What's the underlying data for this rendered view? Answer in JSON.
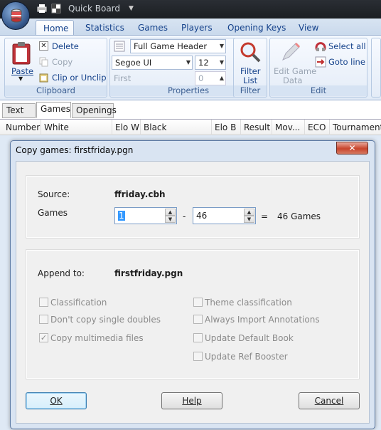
{
  "window": {
    "title": "Quick Board"
  },
  "ribbon": {
    "tabs": [
      "Home",
      "Statistics",
      "Games",
      "Players",
      "Opening Keys",
      "View"
    ],
    "clipboard": {
      "paste": "Paste",
      "delete": "Delete",
      "copy": "Copy",
      "clip": "Clip or Unclip",
      "group": "Clipboard"
    },
    "properties": {
      "header_select": "Full Game Header",
      "font_select": "Segoe UI",
      "size_select": "12",
      "first_label": "First",
      "first_value": "0",
      "group": "Properties"
    },
    "filter": {
      "label1": "Filter",
      "label2": "List",
      "group": "Filter"
    },
    "edit": {
      "edit_label1": "Edit Game",
      "edit_label2": "Data",
      "select_all": "Select all",
      "goto_line": "Goto line",
      "group": "Edit"
    }
  },
  "view_tabs": [
    "Text",
    "Games",
    "Openings"
  ],
  "columns": [
    "Number",
    "White",
    "Elo W",
    "Black",
    "Elo B",
    "Result",
    "Mov...",
    "ECO",
    "Tournament"
  ],
  "dialog": {
    "title": "Copy games: firstfriday.pgn",
    "close": "✕",
    "source_label": "Source:",
    "source_value": "ffriday.cbh",
    "games_label": "Games",
    "from_value": "1",
    "dash": "-",
    "to_value": "46",
    "equals": "=",
    "count_text": "46 Games",
    "append_label": "Append to:",
    "append_value": "firstfriday.pgn",
    "options_left": [
      {
        "label": "Classification",
        "checked": false
      },
      {
        "label": "Don't copy single doubles",
        "checked": false
      },
      {
        "label": "Copy multimedia files",
        "checked": true
      }
    ],
    "options_right": [
      {
        "label": "Theme classification",
        "checked": false
      },
      {
        "label": "Always Import Annotations",
        "checked": false
      },
      {
        "label": "Update Default Book",
        "checked": false
      },
      {
        "label": "Update Ref Booster",
        "checked": false
      }
    ],
    "ok": "OK",
    "help": "Help",
    "cancel": "Cancel"
  }
}
